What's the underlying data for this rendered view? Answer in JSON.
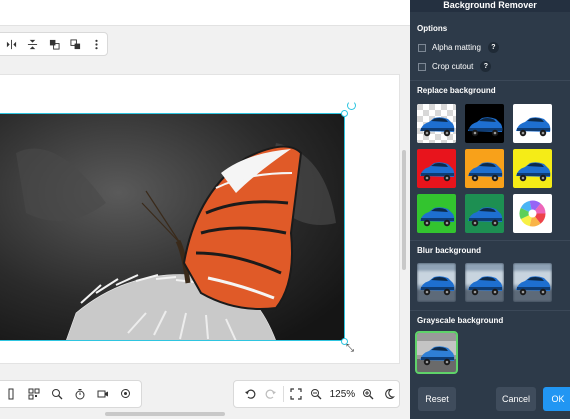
{
  "panel": {
    "title": "Background Remover",
    "options_title": "Options",
    "options": [
      {
        "label": "Alpha matting",
        "checked": false,
        "help": "?"
      },
      {
        "label": "Crop cutout",
        "checked": false,
        "help": "?"
      }
    ],
    "replace_title": "Replace background",
    "replace_swatches": [
      {
        "name": "transparent"
      },
      {
        "name": "black",
        "color": "#000000"
      },
      {
        "name": "white",
        "color": "#ffffff"
      },
      {
        "name": "red",
        "color": "#e8141c"
      },
      {
        "name": "orange",
        "color": "#f8a11a"
      },
      {
        "name": "yellow",
        "color": "#f5ec17"
      },
      {
        "name": "green",
        "color": "#33c42f"
      },
      {
        "name": "dark-green",
        "color": "#1d8f52"
      },
      {
        "name": "color-picker"
      }
    ],
    "blur_title": "Blur background",
    "grayscale_title": "Grayscale background",
    "buttons": {
      "reset": "Reset",
      "cancel": "Cancel",
      "ok": "OK"
    }
  },
  "zoom": {
    "value": "125%"
  },
  "colors": {
    "accent": "#2196f3",
    "selection": "#2ec5e0",
    "panel_bg": "#2d3a49",
    "selected_outline": "#5fd36a"
  }
}
